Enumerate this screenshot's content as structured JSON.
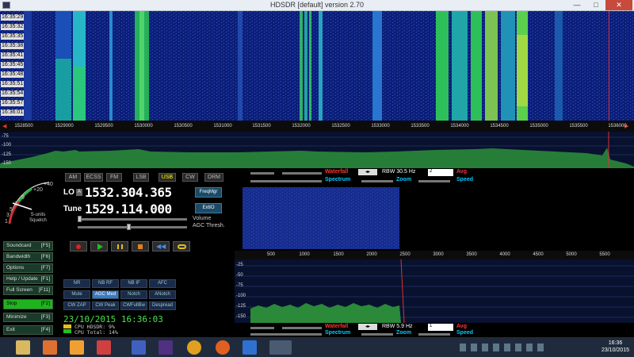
{
  "window": {
    "title": "HDSDR [default]  version 2.70",
    "min": "—",
    "max": "□",
    "close": "✕"
  },
  "waterfall_times": [
    "16:35:29",
    "16:35:32",
    "16:35:35",
    "16:35:38",
    "16:35:41",
    "16:35:45",
    "16:35:48",
    "16:35:51",
    "16:35:54",
    "16:35:57",
    "16:36:01"
  ],
  "freq_ticks": [
    "1528500",
    "1529000",
    "1529500",
    "1530000",
    "1530500",
    "1531000",
    "1531500",
    "1532000",
    "1532500",
    "1533000",
    "1533500",
    "1534000",
    "1534500",
    "1535000",
    "1535500",
    "1536000"
  ],
  "spectrum_db": [
    "-75",
    "-100",
    "-125",
    "-150"
  ],
  "modes": [
    "AM",
    "ECSS",
    "FM",
    "LSB",
    "USB",
    "CW",
    "DRM"
  ],
  "active_mode": "USB",
  "lo": {
    "label": "LO",
    "badge": "A",
    "value": "1532.304.365"
  },
  "tune": {
    "label": "Tune",
    "value": "1529.114.000"
  },
  "freqmgr_label": "FreqMgr",
  "extio_label": "ExtIO",
  "volume_label": "Volume",
  "agc_label": "AGC Thresh.",
  "smeter": {
    "label": "S-units Squelch",
    "marks": [
      "+40",
      "+20",
      "9",
      "7",
      "5",
      "3",
      "1"
    ]
  },
  "side_buttons": [
    {
      "label": "Soundcard",
      "key": "[F5]"
    },
    {
      "label": "Bandwidth",
      "key": "[F6]"
    },
    {
      "label": "Options",
      "key": "[F7]"
    },
    {
      "label": "Help / Update",
      "key": "[F1]"
    },
    {
      "label": "Full Screen",
      "key": "[F11]"
    },
    {
      "label": "Stop",
      "key": "[F2]"
    },
    {
      "label": "Minimize",
      "key": "[F3]"
    },
    {
      "label": "Exit",
      "key": "[F4]"
    }
  ],
  "dsp_buttons": [
    "NR",
    "NB RF",
    "NB IF",
    "AFC",
    "Mute",
    "AGC Med",
    "Notch",
    "ANotch",
    "CW ZAP",
    "CW Peak",
    "CWFullBw",
    "Despread"
  ],
  "dsp_active": "AGC Med",
  "datetime": "23/10/2015 16:36:03",
  "cpu": {
    "hdsdr": "CPU HDSDR: 9%",
    "total": "CPU Total: 14%"
  },
  "top_ctrl": {
    "waterfall": "Waterfall",
    "spectrum": "Spectrum",
    "zoom": "Zoom",
    "speed": "Speed",
    "rbw": "RBW 30.5 Hz",
    "avg_value": "2",
    "avg": "Avg"
  },
  "bottom_ctrl": {
    "waterfall": "Waterfall",
    "spectrum": "Spectrum",
    "zoom": "Zoom",
    "speed": "Speed",
    "rbw": "RBW  5.9 Hz",
    "avg_value": "1",
    "avg": "Avg"
  },
  "af_ticks": [
    "500",
    "1000",
    "1500",
    "2000",
    "2500",
    "3000",
    "3500",
    "4000",
    "4500",
    "5000",
    "5500"
  ],
  "af_db": [
    "-25",
    "-50",
    "-75",
    "-100",
    "-125",
    "-150"
  ],
  "clock": {
    "time": "16:36",
    "date": "23/10/2015"
  },
  "colors": {
    "accent": "#1fb31f",
    "close": "#c74a3c",
    "waterfall_bg": "#0a1a6a"
  }
}
